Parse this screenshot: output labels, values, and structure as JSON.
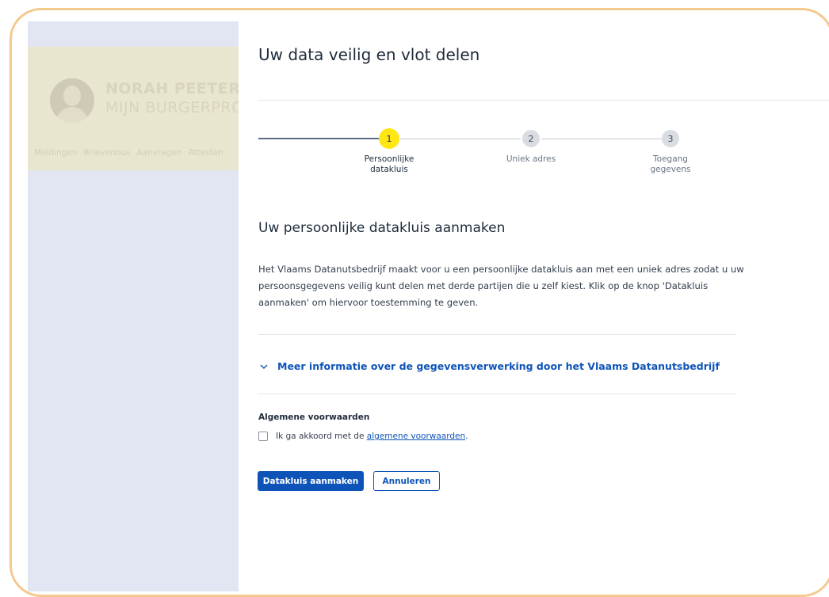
{
  "background_profile": {
    "name": "NORAH PEETERS",
    "subtitle": "MIJN BURGERPROFIEL",
    "tabs": [
      "Meldingen",
      "Brievenbus",
      "Aanvragen",
      "Attesten"
    ]
  },
  "panel": {
    "title": "Uw data veilig en vlot delen",
    "steps": [
      {
        "number": "1",
        "label": "Persoonlijke datakluis",
        "state": "active"
      },
      {
        "number": "2",
        "label": "Uniek adres",
        "state": "todo"
      },
      {
        "number": "3",
        "label": "Toegang gegevens",
        "state": "todo"
      }
    ],
    "section_title": "Uw persoonlijke datakluis aanmaken",
    "intro": "Het Vlaams Datanutsbedrijf maakt voor u een persoonlijke datakluis aan met een uniek adres zodat u uw persoonsgegevens veilig kunt delen met derde partijen die u zelf kiest. Klik op de knop 'Datakluis aanmaken' om hiervoor toestemming te geven.",
    "accordion": {
      "label": "Meer informatie over de gegevensverwerking door het Vlaams Datanutsbedrijf",
      "icon": "chevron-down-icon",
      "expanded": false
    },
    "terms": {
      "title": "Algemene voorwaarden",
      "checkbox_prefix": "Ik ga akkoord met de",
      "link_text": "algemene voorwaarden",
      "suffix": ".",
      "checked": false
    },
    "buttons": {
      "primary": "Datakluis aanmaken",
      "secondary": "Annuleren"
    }
  },
  "colors": {
    "accent_blue": "#0e54b8",
    "active_step_yellow": "#ffe615",
    "frame_border": "#f4c98e"
  }
}
